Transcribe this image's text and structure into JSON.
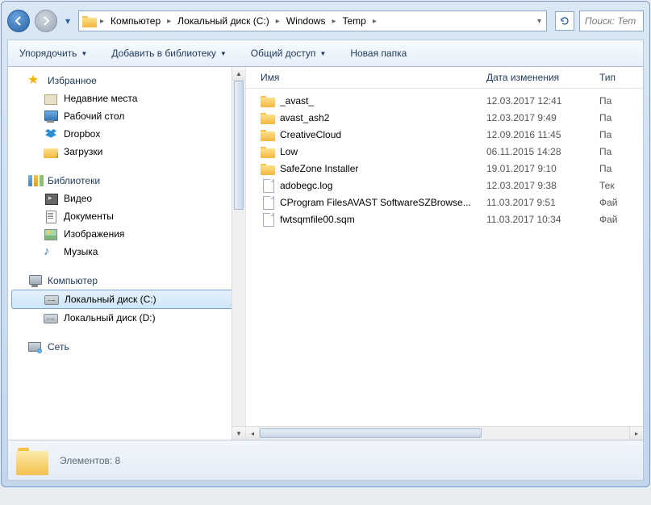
{
  "breadcrumb": {
    "items": [
      "Компьютер",
      "Локальный диск (C:)",
      "Windows",
      "Temp"
    ]
  },
  "search": {
    "placeholder": "Поиск: Tem"
  },
  "toolbar": {
    "organize": "Упорядочить",
    "include": "Добавить в библиотеку",
    "share": "Общий доступ",
    "newfolder": "Новая папка"
  },
  "sidebar": {
    "favorites": {
      "head": "Избранное",
      "items": [
        "Недавние места",
        "Рабочий стол",
        "Dropbox",
        "Загрузки"
      ]
    },
    "libraries": {
      "head": "Библиотеки",
      "items": [
        "Видео",
        "Документы",
        "Изображения",
        "Музыка"
      ]
    },
    "computer": {
      "head": "Компьютер",
      "items": [
        "Локальный диск (C:)",
        "Локальный диск (D:)"
      ]
    },
    "network": {
      "head": "Сеть"
    }
  },
  "columns": {
    "name": "Имя",
    "date": "Дата изменения",
    "type": "Тип"
  },
  "files": [
    {
      "icon": "folder",
      "name": "_avast_",
      "date": "12.03.2017 12:41",
      "type": "Па"
    },
    {
      "icon": "folder",
      "name": "avast_ash2",
      "date": "12.03.2017 9:49",
      "type": "Па"
    },
    {
      "icon": "folder",
      "name": "CreativeCloud",
      "date": "12.09.2016 11:45",
      "type": "Па"
    },
    {
      "icon": "folder",
      "name": "Low",
      "date": "06.11.2015 14:28",
      "type": "Па"
    },
    {
      "icon": "folder",
      "name": "SafeZone Installer",
      "date": "19.01.2017 9:10",
      "type": "Па"
    },
    {
      "icon": "file",
      "name": "adobegc.log",
      "date": "12.03.2017 9:38",
      "type": "Тек"
    },
    {
      "icon": "file",
      "name": "CProgram FilesAVAST SoftwareSZBrowse...",
      "date": "11.03.2017 9:51",
      "type": "Фай"
    },
    {
      "icon": "file",
      "name": "fwtsqmfile00.sqm",
      "date": "11.03.2017 10:34",
      "type": "Фай"
    }
  ],
  "status": {
    "count_label": "Элементов: 8"
  }
}
